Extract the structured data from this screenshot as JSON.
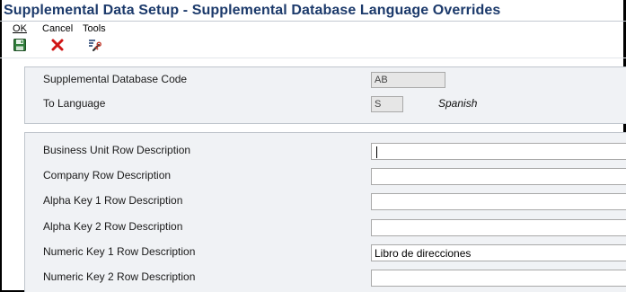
{
  "window": {
    "title": "Supplemental Data Setup - Supplemental Database Language Overrides"
  },
  "toolbar": {
    "ok": {
      "label": "OK",
      "icon": "save-disk-icon"
    },
    "cancel": {
      "label": "Cancel",
      "icon": "red-x-icon"
    },
    "tools": {
      "label": "Tools",
      "icon": "tools-icon"
    }
  },
  "header": {
    "db_code_label": "Supplemental Database Code",
    "db_code_value": "AB",
    "language_label": "To Language",
    "language_value": "S",
    "language_desc": "Spanish"
  },
  "rows": [
    {
      "label": "Business Unit Row Description",
      "value": ""
    },
    {
      "label": "Company Row Description",
      "value": ""
    },
    {
      "label": "Alpha Key 1 Row Description",
      "value": ""
    },
    {
      "label": "Alpha Key 2 Row Description",
      "value": ""
    },
    {
      "label": "Numeric Key 1 Row Description",
      "value": "Libro de direcciones"
    },
    {
      "label": "Numeric Key 2 Row Description",
      "value": ""
    }
  ]
}
